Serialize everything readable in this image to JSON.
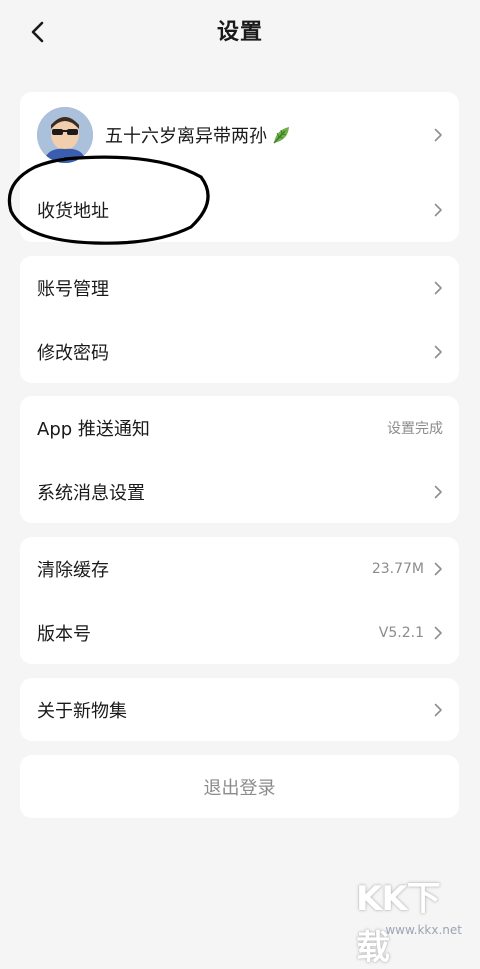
{
  "nav": {
    "title": "设置"
  },
  "profile": {
    "nickname": "五十六岁离异带两孙"
  },
  "groups": [
    {
      "items": [
        {
          "label": "收货地址"
        }
      ]
    },
    {
      "items": [
        {
          "label": "账号管理"
        },
        {
          "label": "修改密码"
        }
      ]
    },
    {
      "items": [
        {
          "label": "App 推送通知",
          "value": "设置完成"
        },
        {
          "label": "系统消息设置"
        }
      ]
    },
    {
      "items": [
        {
          "label": "清除缓存",
          "value": "23.77M"
        },
        {
          "label": "版本号",
          "value": "V5.2.1"
        }
      ]
    },
    {
      "items": [
        {
          "label": "关于新物集"
        }
      ]
    }
  ],
  "logout": {
    "label": "退出登录"
  },
  "watermark": {
    "logo": "KK下载",
    "url": "www.kkx.net"
  },
  "colors": {
    "background": "#f5f5f5",
    "card": "#ffffff",
    "muted_text": "#8c8c8c",
    "annotation": "#000000"
  },
  "icons": [
    "back-arrow-icon",
    "leaf-icon",
    "chevron-right-icon"
  ]
}
